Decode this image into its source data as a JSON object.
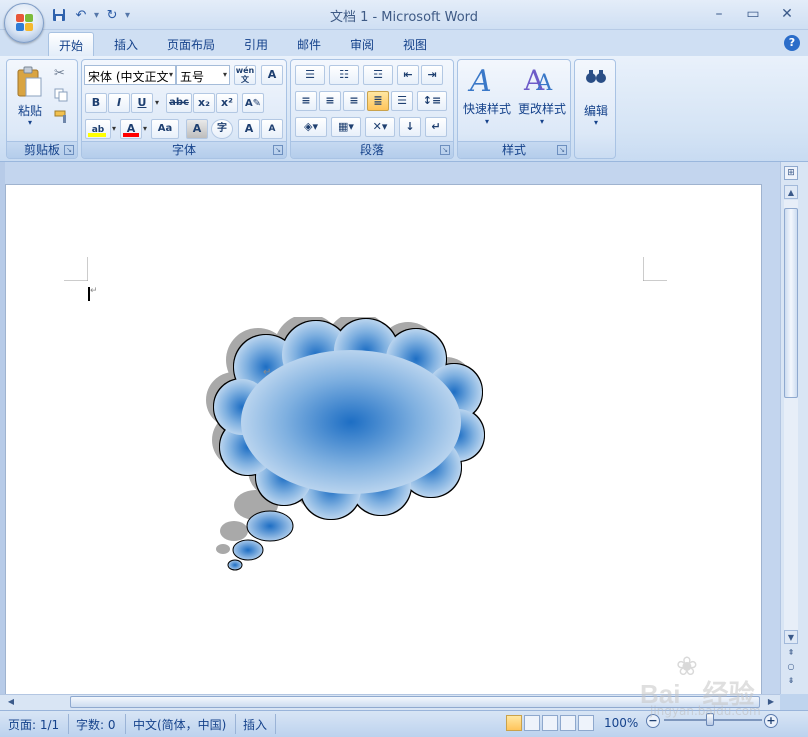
{
  "window": {
    "title": "文档 1 - Microsoft Word",
    "minimize": "–",
    "maximize": "▭",
    "close": "✕"
  },
  "qat": {
    "save": "💾",
    "undo": "↶",
    "redo": "↻",
    "more": "▾"
  },
  "tabs": [
    {
      "label": "开始",
      "active": true
    },
    {
      "label": "插入"
    },
    {
      "label": "页面布局"
    },
    {
      "label": "引用"
    },
    {
      "label": "邮件"
    },
    {
      "label": "审阅"
    },
    {
      "label": "视图"
    }
  ],
  "help": "?",
  "ribbon": {
    "clipboard": {
      "label": "剪贴板",
      "paste": "粘贴"
    },
    "font": {
      "label": "字体",
      "font_name": "宋体 (中文正文",
      "font_size": "五号",
      "bold": "B",
      "italic": "I",
      "underline": "U",
      "strike": "abc",
      "sub": "x₂",
      "sup": "x²",
      "grow": "A",
      "shrink": "A",
      "case": "Aa",
      "char_border": "A",
      "enclosed": "字",
      "phonetic": "wén 文",
      "clear": "A"
    },
    "paragraph": {
      "label": "段落"
    },
    "styles": {
      "label": "样式",
      "quick_styles": "快速样式",
      "change_styles": "更改样式"
    },
    "editing": {
      "label": "编辑"
    }
  },
  "document": {
    "paragraph_mark": "↵",
    "shape": "cloud-callout"
  },
  "status": {
    "page": "页面: 1/1",
    "words": "字数: 0",
    "language": "中文(简体，中国)",
    "mode": "插入",
    "zoom": "100%"
  },
  "watermark": {
    "brand": "Bai",
    "brand2": "经验",
    "url": "jingyan.baidu.com"
  },
  "colors": {
    "accent": "#15428b",
    "highlight": "#ffff00",
    "font_color": "#ff0000",
    "cloud_center": "#1d6ec4",
    "cloud_edge": "#c8ddf2"
  }
}
